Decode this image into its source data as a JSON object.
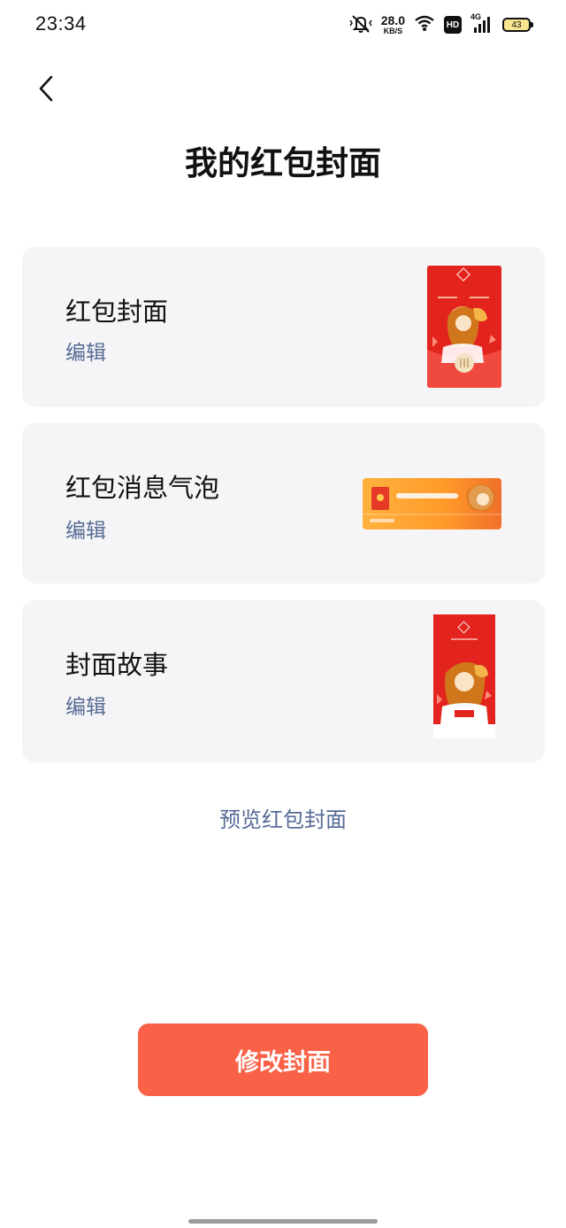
{
  "status_bar": {
    "time": "23:34",
    "net_speed_value": "28.0",
    "net_speed_unit": "KB/S",
    "hd_label": "HD",
    "network_label": "4G",
    "battery_level": "43",
    "icons": [
      "mute-bell-icon",
      "wifi-icon",
      "hd-icon",
      "signal-icon",
      "battery-icon"
    ]
  },
  "nav": {
    "back_icon": "chevron-left-icon",
    "title": "我的红包封面"
  },
  "cards": [
    {
      "title": "红包封面",
      "edit_label": "编辑",
      "thumbnail": "red-packet-cover-image"
    },
    {
      "title": "红包消息气泡",
      "edit_label": "编辑",
      "thumbnail": "message-bubble-image"
    },
    {
      "title": "封面故事",
      "edit_label": "编辑",
      "thumbnail": "cover-story-image"
    }
  ],
  "preview_link": "预览红包封面",
  "primary_button": "修改封面",
  "colors": {
    "link": "#576b95",
    "primary": "#fa6248",
    "card_bg": "#f5f5f7",
    "cover_red": "#e0201c"
  }
}
